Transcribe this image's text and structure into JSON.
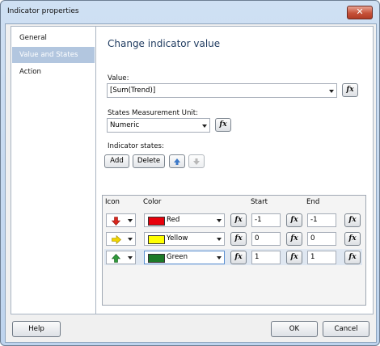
{
  "window": {
    "title": "Indicator properties",
    "close_glyph": "✕"
  },
  "nav": {
    "items": [
      "General",
      "Value and States",
      "Action"
    ],
    "selected": 1
  },
  "page": {
    "heading": "Change indicator value",
    "value_label": "Value:",
    "value": "[Sum(Trend)]",
    "unit_label": "States Measurement Unit:",
    "unit_value": "Numeric",
    "states_label": "Indicator states:",
    "add_label": "Add",
    "delete_label": "Delete",
    "fx_glyph": "fx"
  },
  "grid": {
    "headers": {
      "icon": "Icon",
      "color": "Color",
      "start": "Start",
      "end": "End"
    },
    "rows": [
      {
        "icon": "down-arrow-icon",
        "color_name": "Red",
        "color_hex": "#e8000b",
        "start": "-1",
        "end": "-1"
      },
      {
        "icon": "right-arrow-icon",
        "color_name": "Yellow",
        "color_hex": "#ffff00",
        "start": "0",
        "end": "0"
      },
      {
        "icon": "up-arrow-icon",
        "color_name": "Green",
        "color_hex": "#1c7a28",
        "start": "1",
        "end": "1"
      }
    ]
  },
  "footer": {
    "help": "Help",
    "ok": "OK",
    "cancel": "Cancel"
  }
}
